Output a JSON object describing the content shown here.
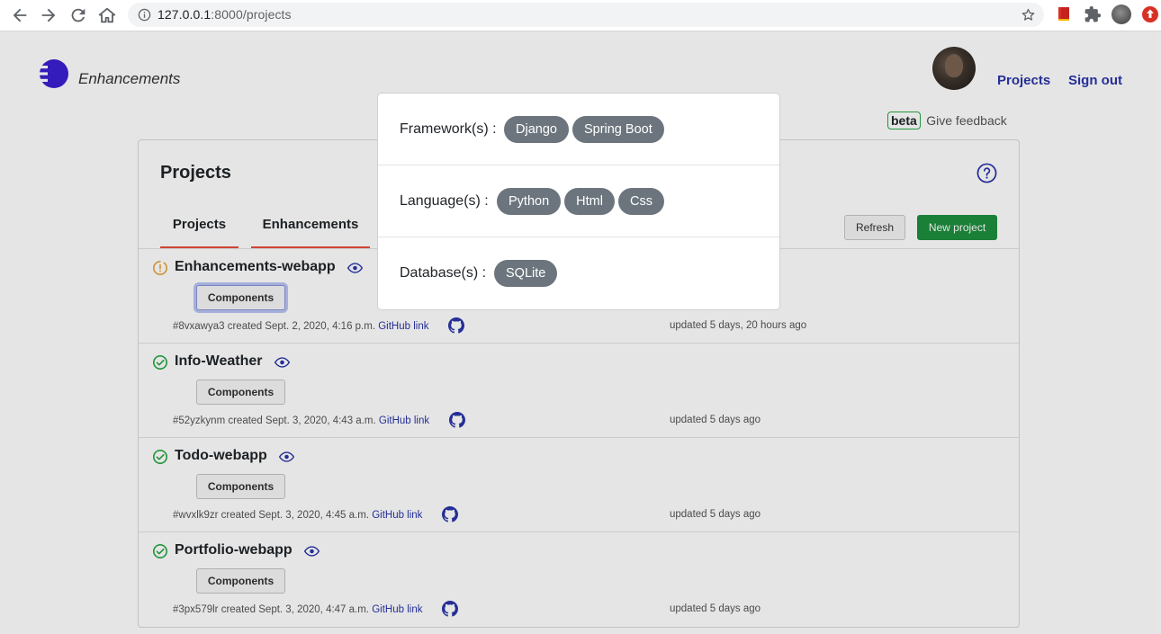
{
  "browser": {
    "url_host": "127.0.0.1",
    "url_path": ":8000/projects"
  },
  "app": {
    "name": "Enhancements",
    "brand_color": "#3a1fd1"
  },
  "header": {
    "projects_link": "Projects",
    "signout_link": "Sign out",
    "beta_badge": "beta",
    "feedback_text": "Give feedback"
  },
  "card": {
    "title": "Projects",
    "tabs": [
      {
        "label": "Projects"
      },
      {
        "label": "Enhancements"
      }
    ],
    "refresh_label": "Refresh",
    "new_project_label": "New project"
  },
  "projects": [
    {
      "name": "Enhancements-webapp",
      "status": "pending",
      "components_label": "Components",
      "meta": "#8vxawya3 created Sept. 2, 2020, 4:16 p.m.",
      "github_label": "GitHub link",
      "updated": "updated 5 days, 20 hours ago"
    },
    {
      "name": "Info-Weather",
      "status": "ok",
      "components_label": "Components",
      "meta": "#52yzkynm created Sept. 3, 2020, 4:43 a.m.",
      "github_label": "GitHub link",
      "updated": "updated 5 days ago"
    },
    {
      "name": "Todo-webapp",
      "status": "ok",
      "components_label": "Components",
      "meta": "#wvxlk9zr created Sept. 3, 2020, 4:45 a.m.",
      "github_label": "GitHub link",
      "updated": "updated 5 days ago"
    },
    {
      "name": "Portfolio-webapp",
      "status": "ok",
      "components_label": "Components",
      "meta": "#3px579lr created Sept. 3, 2020, 4:47 a.m.",
      "github_label": "GitHub link",
      "updated": "updated 5 days ago"
    }
  ],
  "modal": {
    "sections": [
      {
        "label": "Framework(s) :",
        "tags": [
          "Django",
          "Spring Boot"
        ]
      },
      {
        "label": "Language(s) :",
        "tags": [
          "Python",
          "Html",
          "Css"
        ]
      },
      {
        "label": "Database(s) :",
        "tags": [
          "SQLite"
        ]
      }
    ]
  },
  "colors": {
    "link": "#2a35a8",
    "success": "#28a745",
    "warning": "#e8a33d",
    "tab_underline": "#e74c3c",
    "tag_bg": "#6c757d"
  },
  "icons": [
    "back-icon",
    "forward-icon",
    "reload-icon",
    "home-icon",
    "info-icon",
    "star-icon",
    "extension-icon",
    "puzzle-icon",
    "profile-icon",
    "update-icon",
    "help-icon",
    "eye-icon",
    "check-circle-icon",
    "warning-circle-icon",
    "github-icon"
  ]
}
